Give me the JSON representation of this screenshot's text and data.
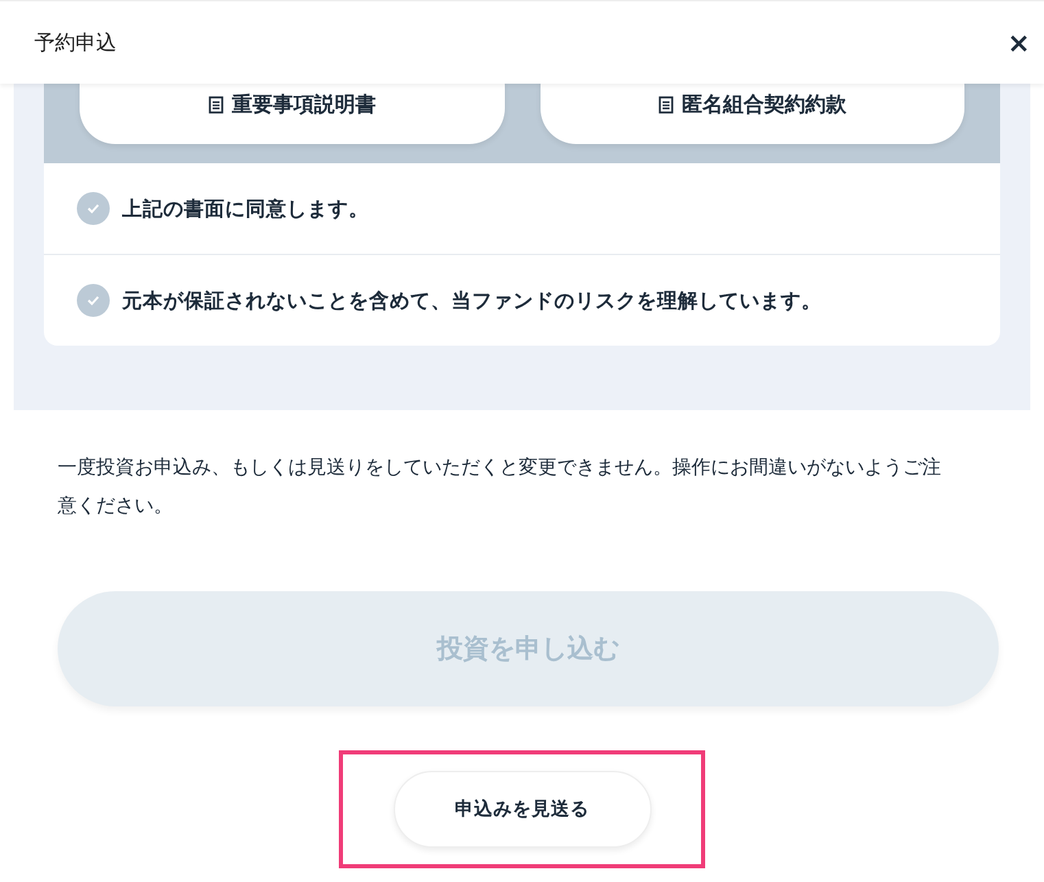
{
  "window": {
    "title": "予約申込",
    "close_label": "×"
  },
  "documents": [
    {
      "label": "重要事項説明書"
    },
    {
      "label": "匿名組合契約約款"
    }
  ],
  "agreements": [
    {
      "label": "上記の書面に同意します。",
      "checked": false
    },
    {
      "label": "元本が保証されないことを含めて、当ファンドのリスクを理解しています。",
      "checked": false
    }
  ],
  "notice": "一度投資お申込み、もしくは見送りをしていただくと変更できません。操作にお間違いがないようご注意ください。",
  "submit_button": {
    "label": "投資を申し込む",
    "disabled": true
  },
  "decline_button": {
    "label": "申込みを見送る",
    "highlighted": true
  }
}
